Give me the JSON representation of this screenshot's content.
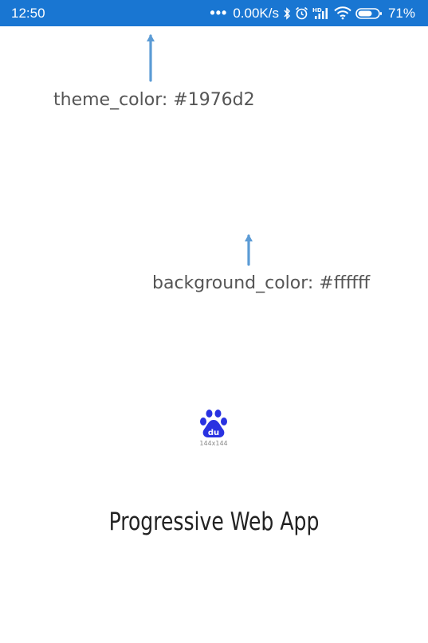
{
  "status_bar": {
    "time": "12:50",
    "dots": "•••",
    "net_speed": "0.00K/s",
    "icons": [
      "bluetooth-icon",
      "alarm-icon",
      "hd-signal-icon",
      "wifi-icon",
      "battery-icon"
    ],
    "battery": "71%",
    "background_color": "#1976d2",
    "text_color": "#ffffff",
    "battery_level": 0.71
  },
  "annotations": {
    "theme_color": "theme_color: #1976d2",
    "background_color": "background_color: #ffffff",
    "arrow_color": "#5b9bd5"
  },
  "splash": {
    "icon": "baidu-paw-icon",
    "icon_caption": "144x144",
    "icon_color": "#2932e1",
    "app_name": "Progressive Web App",
    "background": "#ffffff"
  }
}
